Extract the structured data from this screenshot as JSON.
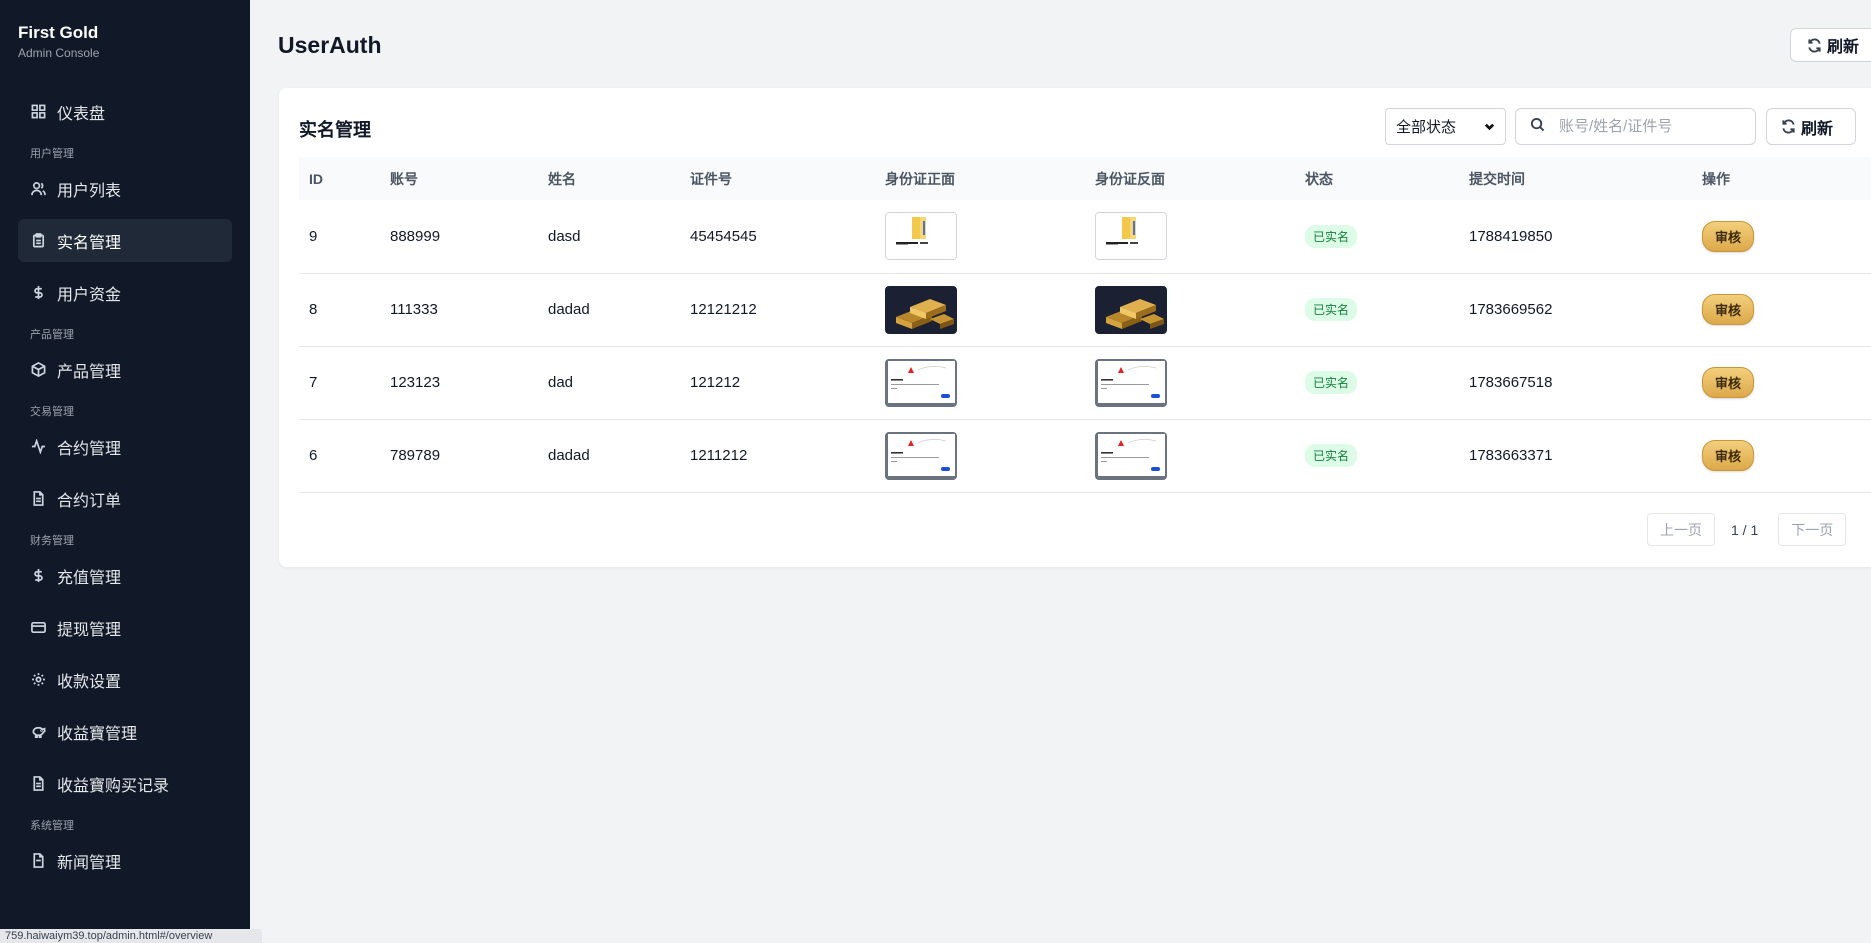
{
  "sidebar": {
    "brand_title": "First Gold",
    "brand_sub": "Admin Console",
    "items": {
      "dashboard": "仪表盘",
      "group_user": "用户管理",
      "user_list": "用户列表",
      "realname": "实名管理",
      "user_funds": "用户资金",
      "group_product": "产品管理",
      "product_mgmt": "产品管理",
      "group_trade": "交易管理",
      "contract_mgmt": "合约管理",
      "contract_orders": "合约订单",
      "group_finance": "财务管理",
      "recharge": "充值管理",
      "withdraw": "提现管理",
      "payment_settings": "收款设置",
      "yield_mgmt": "收益寶管理",
      "yield_records": "收益寶购买记录",
      "group_system": "系统管理",
      "news": "新闻管理"
    },
    "active": "实名管理"
  },
  "statusbar": {
    "url": "759.haiwaiym39.top/admin.html#/overview"
  },
  "header": {
    "title": "UserAuth",
    "refresh_label": "刷新"
  },
  "card": {
    "title": "实名管理",
    "status_filter": {
      "selected": "全部状态"
    },
    "search": {
      "placeholder": "账号/姓名/证件号",
      "value": ""
    },
    "refresh_label": "刷新",
    "columns": {
      "id": "ID",
      "account": "账号",
      "name": "姓名",
      "id_number": "证件号",
      "front": "身份证正面",
      "back": "身份证反面",
      "status": "状态",
      "submitted": "提交时间",
      "action": "操作"
    },
    "rows": [
      {
        "id": "9",
        "account": "888999",
        "name": "dasd",
        "id_number": "45454545",
        "image": "folder-image",
        "status": "已实名",
        "submitted": "1788419850",
        "action": "审核"
      },
      {
        "id": "8",
        "account": "111333",
        "name": "dadad",
        "id_number": "12121212",
        "image": "gold-bars-image",
        "status": "已实名",
        "submitted": "1783669562",
        "action": "审核"
      },
      {
        "id": "7",
        "account": "123123",
        "name": "dad",
        "id_number": "121212",
        "image": "screenshot-image",
        "status": "已实名",
        "submitted": "1783667518",
        "action": "审核"
      },
      {
        "id": "6",
        "account": "789789",
        "name": "dadad",
        "id_number": "1211212",
        "image": "screenshot-image",
        "status": "已实名",
        "submitted": "1783663371",
        "action": "审核"
      }
    ],
    "pagination": {
      "prev": "上一页",
      "info": "1 / 1",
      "next": "下一页"
    }
  },
  "colors": {
    "sidebar_bg": "#111827",
    "sidebar_active": "#1f2937",
    "badge_bg": "#dcfce7",
    "badge_text": "#15803d",
    "audit_gold": "#dca94a"
  }
}
